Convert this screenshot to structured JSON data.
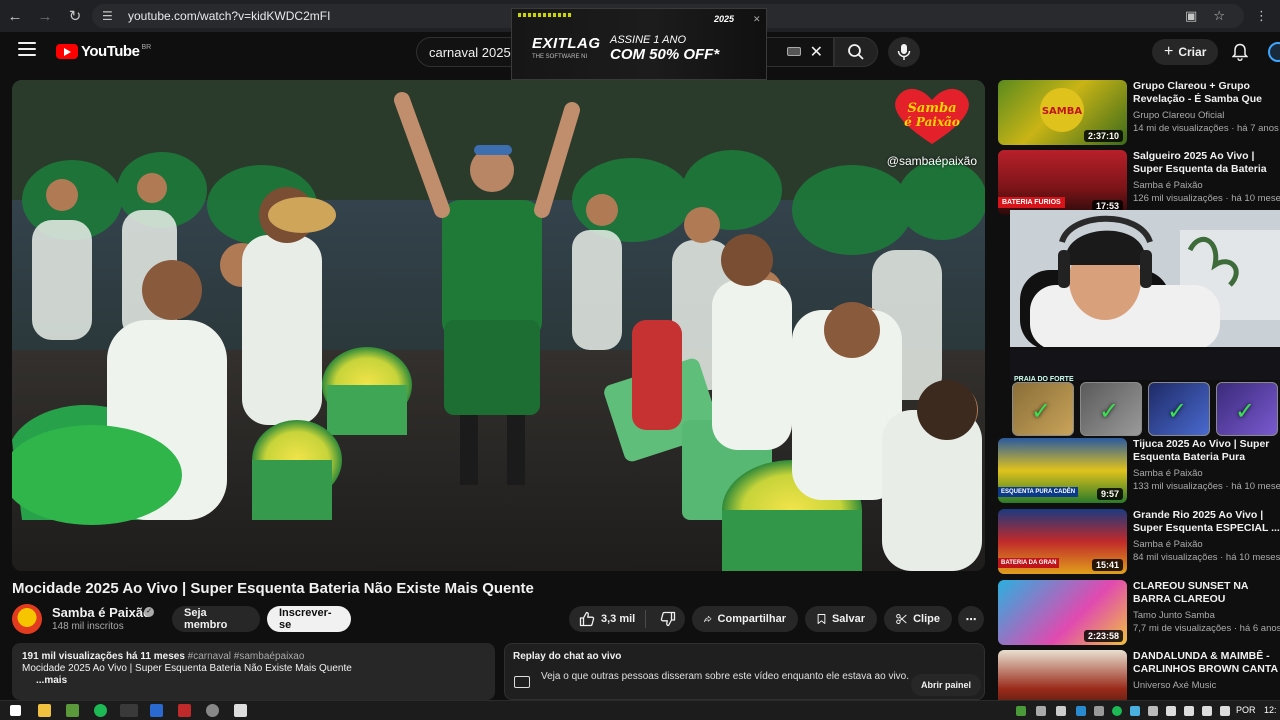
{
  "browser": {
    "url": "youtube.com/watch?v=kidKWDC2mFI"
  },
  "header": {
    "logo_text": "YouTube",
    "logo_country": "BR",
    "search_query": "carnaval 2025",
    "create_label": "Criar"
  },
  "ad": {
    "brand": "EXITLAG",
    "brand_sub": "THE SOFTWARE NI",
    "line1": "ASSINE 1 ANO",
    "line2": "COM 50% OFF*",
    "year": "2025"
  },
  "player": {
    "watermark": "@sambaépaixão",
    "overlay_logo": "Samba é Paixão"
  },
  "video": {
    "title": "Mocidade 2025 Ao Vivo | Super Esquenta Bateria Não Existe Mais Quente",
    "channel": "Samba é Paixão",
    "subscribers": "148 mil inscritos",
    "member_label": "Seja membro",
    "subscribe_label": "Inscrever-se",
    "likes": "3,3 mil",
    "share_label": "Compartilhar",
    "save_label": "Salvar",
    "clip_label": "Clipe"
  },
  "description": {
    "views_time": "191 mil visualizações  há 11 meses",
    "tags": "#carnaval #sambaépaixao",
    "text": "Mocidade 2025 Ao Vivo |  Super Esquenta Bateria Não Existe Mais Quente",
    "more": "...mais"
  },
  "chat": {
    "title": "Replay do chat ao vivo",
    "body": "Veja o que outras pessoas disseram sobre este vídeo enquanto ele estava ao vivo.",
    "open_label": "Abrir painel"
  },
  "recommendations": [
    {
      "title": "Grupo Clareou + Grupo Revelação - É Samba Que Fala",
      "channel": "Grupo Clareou Oficial",
      "meta": "14 mi de visualizações · há 7 anos",
      "duration": "2:37:10"
    },
    {
      "title": "Salgueiro 2025 Ao Vivo | Super Esquenta da Bateria Furiosa | ...",
      "channel": "Samba é Paixão",
      "meta": "126 mil visualizações · há 10 meses",
      "duration": "17:53",
      "badge": "BATERIA FURIOS"
    },
    {
      "title": "Tijuca 2025 Ao Vivo |  Super Esquenta Bateria Pura Cadênc",
      "channel": "Samba é Paixão",
      "meta": "133 mil visualizações · há 10 meses",
      "duration": "9:57",
      "badge": "ESQUENTA PURA CADÊN"
    },
    {
      "title": "Grande Rio 2025 Ao Vivo | Super Esquenta ESPECIAL ...",
      "channel": "Samba é Paixão",
      "meta": "84 mil visualizações · há 10 meses",
      "duration": "15:41",
      "badge": "BATERIA DA GRAN"
    },
    {
      "title": "CLAREOU SUNSET NA BARRA CLAREOU",
      "channel": "Tamo Junto Samba",
      "meta": "7,7 mi de visualizações · há 6 anos",
      "duration": "2:23:58"
    },
    {
      "title": "DANDALUNDA & MAIMBÊ - CARLINHOS BROWN CANTA ...",
      "channel": "Universo Axé Music",
      "meta": "",
      "duration": ""
    }
  ],
  "overlay": {
    "trophy_label": "PRAIA DO FORTE"
  },
  "taskbar": {
    "language": "POR",
    "clock": "12:"
  }
}
